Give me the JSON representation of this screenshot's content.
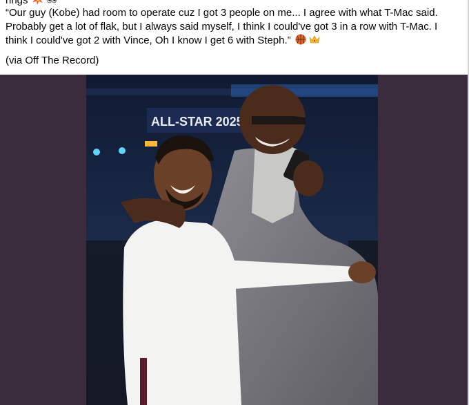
{
  "post": {
    "prev_line": "rings",
    "quote": "“Our guy (Kobe) had room to operate cuz I got 3 people on me... I agree with what T-Mac said. Probably get a lot of flak, but I always said myself, I think I could've got 3 in a row with T-Mac. I think I could've got 2 with Vince, Oh I know I get 6 with Steph.”",
    "via": "(via Off The Record)"
  },
  "photo": {
    "banner_text": "ALL-STAR 2025"
  },
  "colors": {
    "post_bg": "#ffffff",
    "media_bg": "#3a2b3d",
    "text": "#050505"
  },
  "icons": [
    "collision-emoji",
    "eyes-emoji",
    "basketball-emoji",
    "crown-emoji"
  ]
}
